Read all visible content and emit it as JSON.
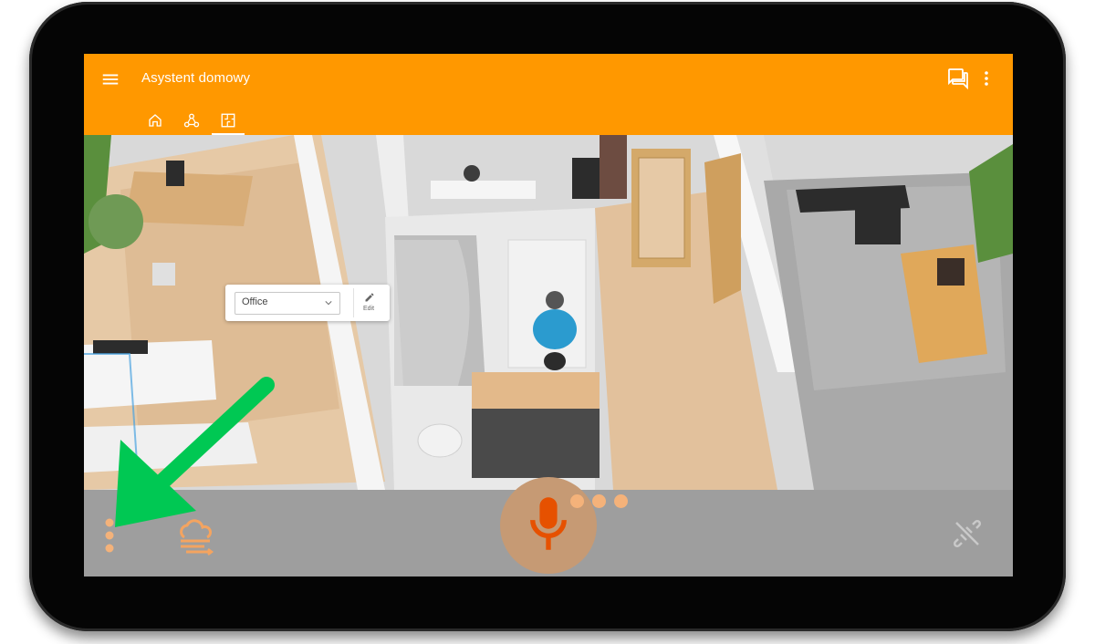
{
  "app": {
    "title": "Asystent domowy"
  },
  "toolbar": {
    "menu_icon": "hamburger-menu-icon",
    "actions": [
      {
        "name": "conversations-icon"
      },
      {
        "name": "more-vert-icon"
      }
    ]
  },
  "tabs": [
    {
      "icon": "home-icon",
      "active": false
    },
    {
      "icon": "devices-graph-icon",
      "active": false
    },
    {
      "icon": "floorplan-icon",
      "active": true
    }
  ],
  "floorplan": {
    "room_selector": {
      "value": "Office",
      "edit_label": "Edit"
    }
  },
  "bottom_bar": {
    "left_icons": [
      "more-vert-dots-icon",
      "weather-fog-icon"
    ],
    "center": "microphone-icon",
    "listening_dots": 3,
    "right_icon": "connection-off-icon"
  },
  "annotation": {
    "arrow": "green-arrow-icon"
  },
  "colors": {
    "appbar": "#ff9800",
    "bottom_bar": "#9e9e9e",
    "mic_bg": "#c69a74",
    "mic_icon": "#e65100",
    "accent_icons": "#f4a460",
    "arrow": "#00c853"
  }
}
